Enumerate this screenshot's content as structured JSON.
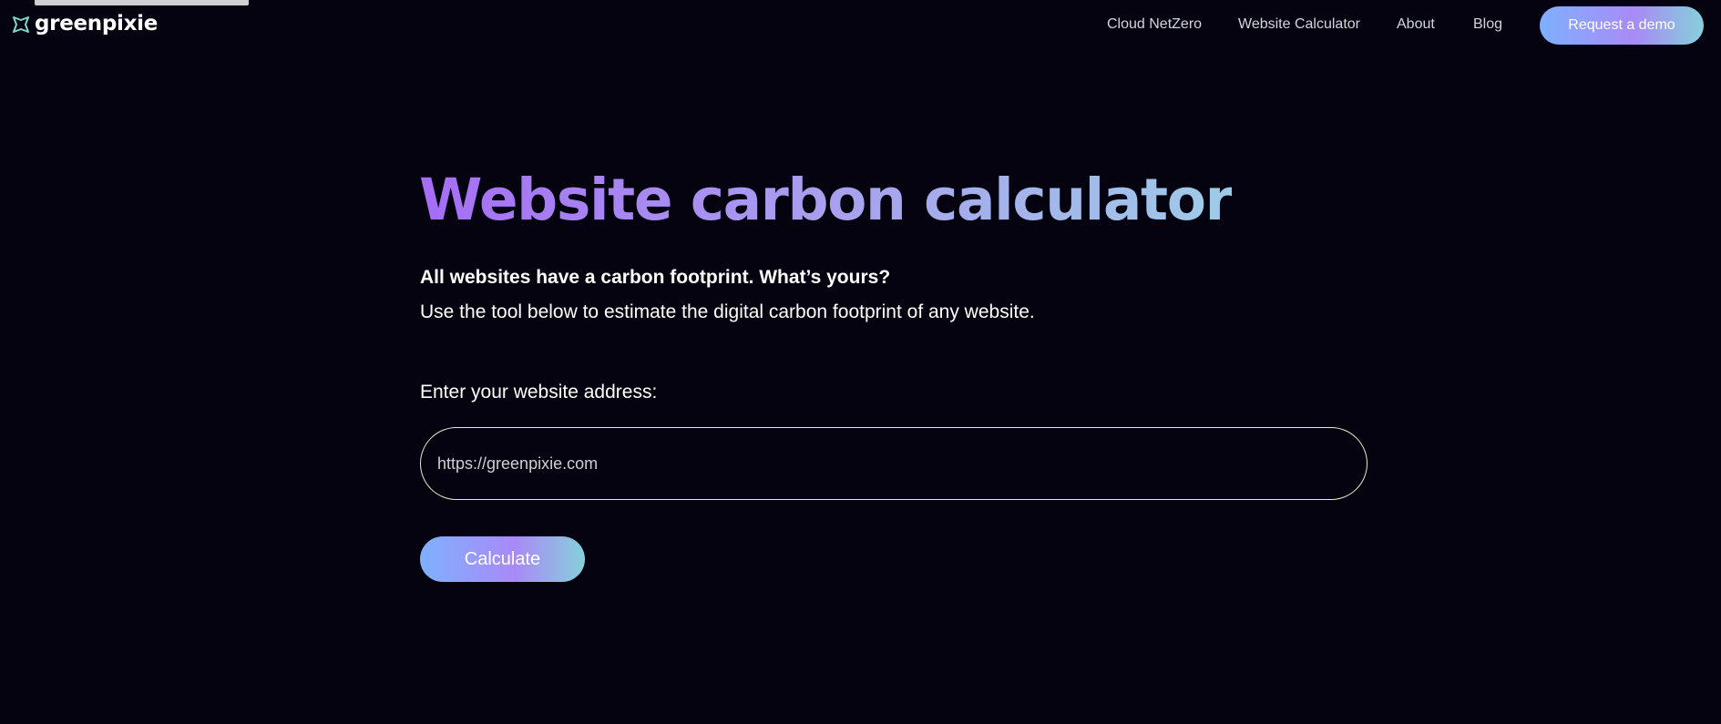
{
  "brand": {
    "name": "greenpixie",
    "logo_icon": "greenpixie-logo-icon",
    "logo_color": "#7fd8c6"
  },
  "nav": {
    "links": [
      {
        "label": "Cloud NetZero"
      },
      {
        "label": "Website Calculator"
      },
      {
        "label": "About"
      },
      {
        "label": "Blog"
      }
    ],
    "cta_label": "Request a demo"
  },
  "hero": {
    "title": "Website carbon calculator",
    "lead": "All websites have a carbon footprint. What’s yours?",
    "subtitle": "Use the tool below to estimate the digital carbon footprint of any website."
  },
  "form": {
    "label": "Enter your website address:",
    "url_placeholder": "https://greenpixie.com",
    "url_value": "",
    "submit_label": "Calculate"
  },
  "colors": {
    "background": "#04030f",
    "accent_purple": "#a56df5",
    "accent_blue": "#7fb0ff",
    "accent_teal": "#86d0da"
  }
}
